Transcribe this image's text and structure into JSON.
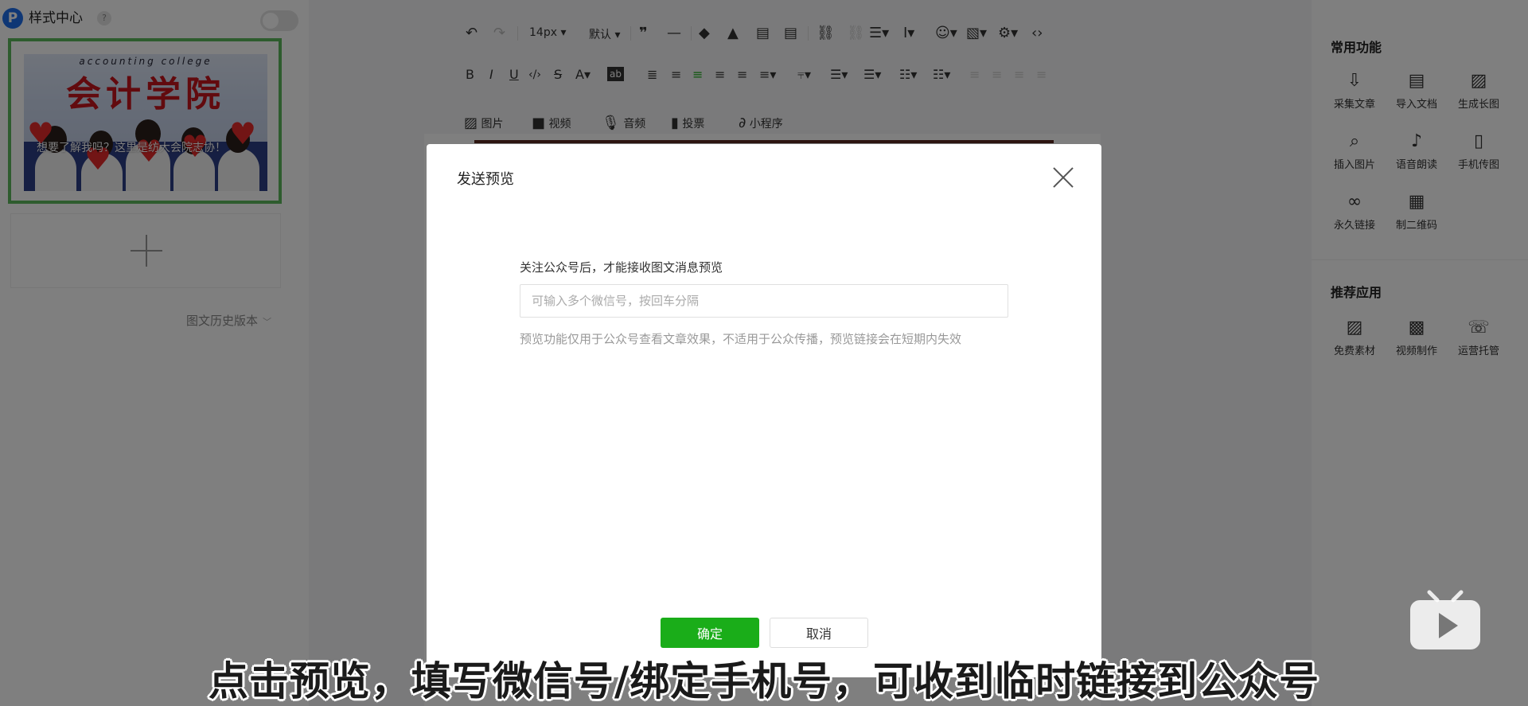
{
  "left_panel": {
    "logo_letter": "P",
    "title": "样式中心",
    "help": "?",
    "cover": {
      "subtitle": "accounting college",
      "big_title": "会计学院",
      "caption": "想要了解我吗？这里是纺大会院志协！"
    },
    "history_label": "图文历史版本"
  },
  "toolbar": {
    "font_size": "14px",
    "font_style": "默认",
    "insert": {
      "image": "图片",
      "video": "视频",
      "audio": "音频",
      "vote": "投票",
      "miniprogram": "小程序"
    }
  },
  "right_panel": {
    "common_title": "常用功能",
    "common_items": [
      {
        "label": "采集文章",
        "icon": "download-icon"
      },
      {
        "label": "导入文档",
        "icon": "word-doc-icon"
      },
      {
        "label": "生成长图",
        "icon": "long-image-icon"
      },
      {
        "label": "插入图片",
        "icon": "search-icon"
      },
      {
        "label": "语音朗读",
        "icon": "voice-read-icon"
      },
      {
        "label": "手机传图",
        "icon": "phone-upload-icon"
      },
      {
        "label": "永久链接",
        "icon": "link-icon"
      },
      {
        "label": "制二维码",
        "icon": "qrcode-icon"
      }
    ],
    "recommend_title": "推荐应用",
    "recommend_items": [
      {
        "label": "免费素材",
        "icon": "image-icon"
      },
      {
        "label": "视频制作",
        "icon": "video-clapper-icon"
      },
      {
        "label": "运营托管",
        "icon": "chat-icon"
      }
    ]
  },
  "modal": {
    "title": "发送预览",
    "label": "关注公众号后，才能接收图文消息预览",
    "input_placeholder": "可输入多个微信号，按回车分隔",
    "input_value": "",
    "note": "预览功能仅用于公众号查看文章效果，不适用于公众传播，预览链接会在短期内失效",
    "confirm_label": "确定",
    "cancel_label": "取消"
  },
  "subtitle": "点击预览，填写微信号/绑定手机号，可收到临时链接到公众号",
  "colors": {
    "accent_green": "#1aad19",
    "overlay": "rgba(0,0,0,0.5)"
  }
}
